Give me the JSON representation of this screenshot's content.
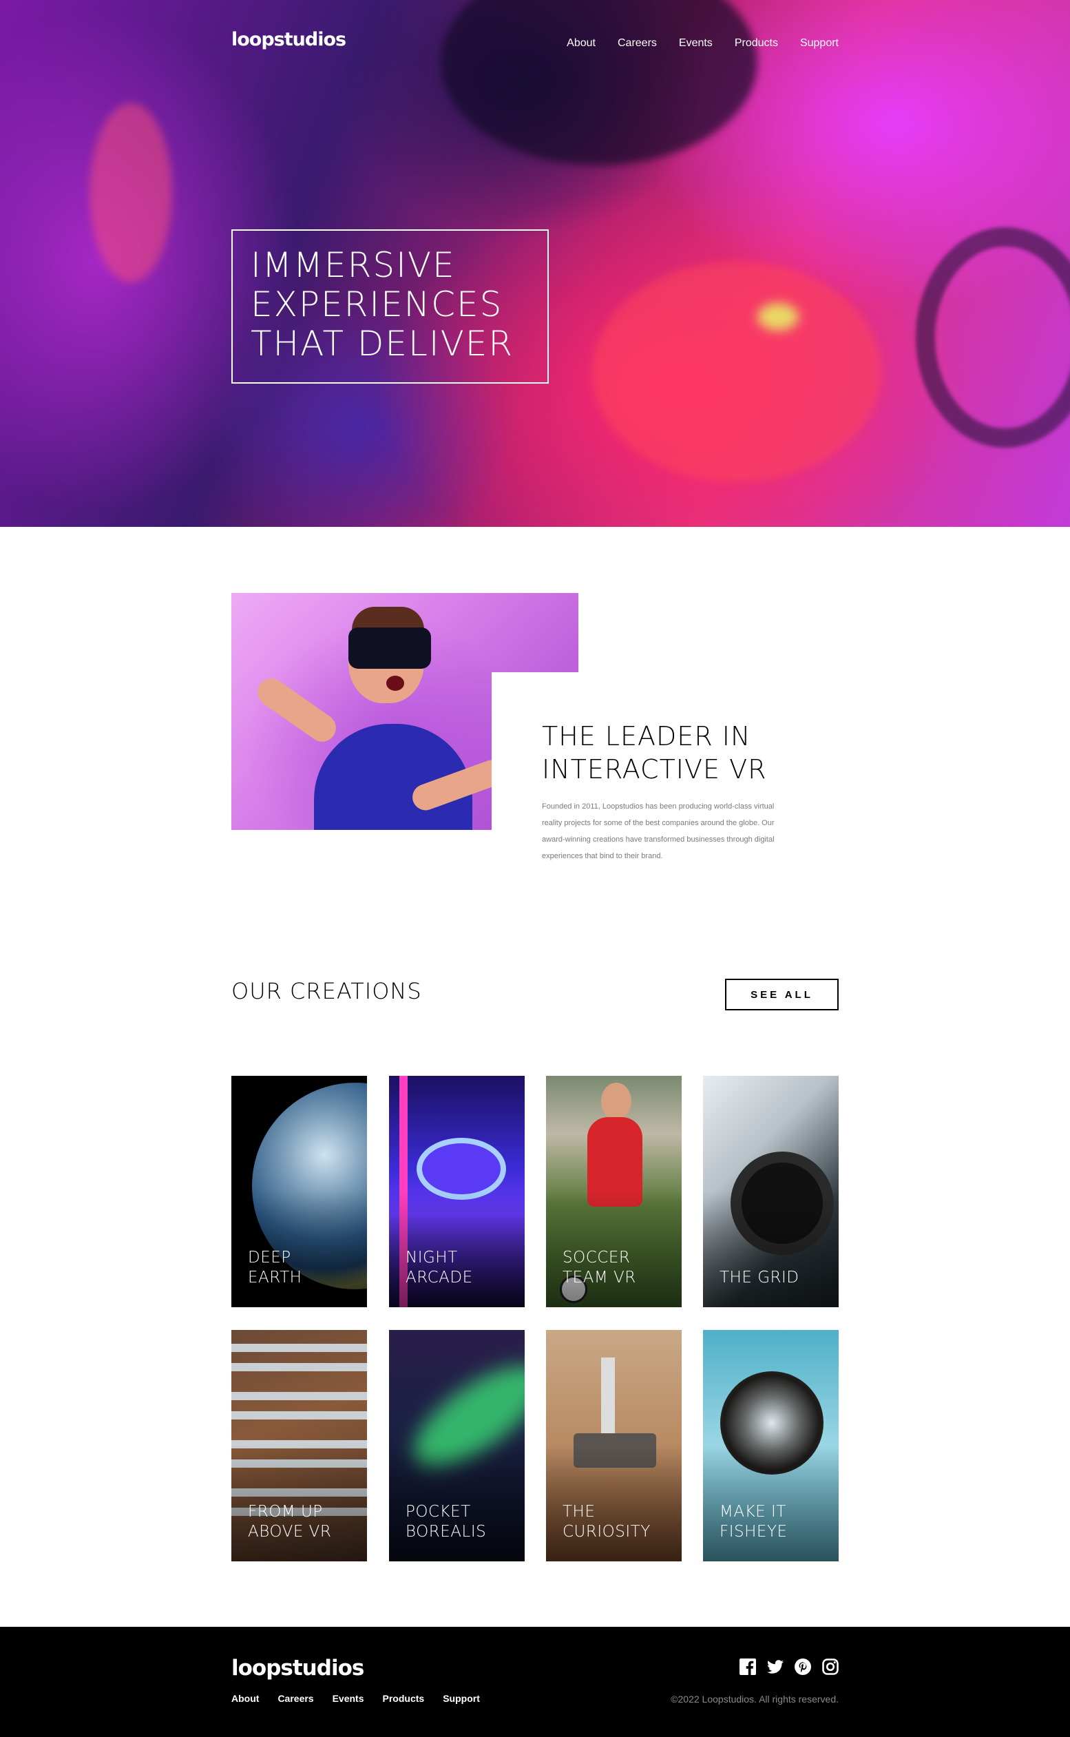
{
  "header": {
    "logo": "loopstudios",
    "nav": [
      "About",
      "Careers",
      "Events",
      "Products",
      "Support"
    ]
  },
  "hero": {
    "title_lines": [
      "IMMERSIVE",
      "EXPERIENCES",
      "THAT DELIVER"
    ]
  },
  "about": {
    "title_lines": [
      "THE LEADER IN",
      "INTERACTIVE VR"
    ],
    "body": "Founded in 2011, Loopstudios has been producing world-class virtual reality projects for some of the best companies around the globe. Our award-winning creations have transformed businesses through digital experiences that bind to their brand."
  },
  "creations": {
    "title": "OUR CREATIONS",
    "see_all": "SEE ALL",
    "items": [
      {
        "lines": [
          "DEEP",
          "EARTH"
        ]
      },
      {
        "lines": [
          "NIGHT",
          "ARCADE"
        ]
      },
      {
        "lines": [
          "SOCCER",
          "TEAM VR"
        ]
      },
      {
        "lines": [
          "THE GRID"
        ]
      },
      {
        "lines": [
          "FROM UP",
          "ABOVE VR"
        ]
      },
      {
        "lines": [
          "POCKET",
          "BOREALIS"
        ]
      },
      {
        "lines": [
          "THE",
          "CURIOSITY"
        ]
      },
      {
        "lines": [
          "MAKE IT",
          "FISHEYE"
        ]
      }
    ]
  },
  "footer": {
    "logo": "loopstudios",
    "nav": [
      "About",
      "Careers",
      "Events",
      "Products",
      "Support"
    ],
    "social_icons": [
      "facebook-icon",
      "twitter-icon",
      "pinterest-icon",
      "instagram-icon"
    ],
    "copyright": "©2022 Loopstudios. All rights reserved."
  }
}
